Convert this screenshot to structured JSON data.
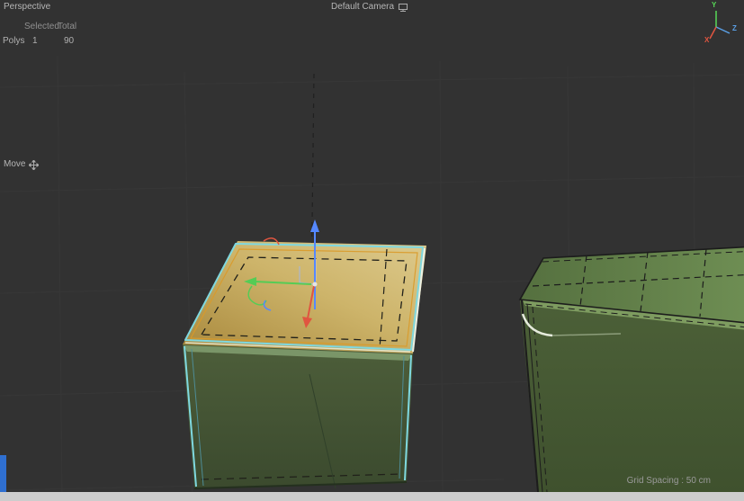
{
  "viewport": {
    "view_label": "Perspective",
    "camera_label": "Default Camera",
    "tool_label": "Move",
    "grid_spacing_label": "Grid Spacing : 50 cm"
  },
  "stats": {
    "header_selected": "Selected",
    "header_total": "Total",
    "rows": [
      {
        "label": "Polys",
        "selected": "1",
        "total": "90"
      }
    ]
  },
  "axis_gizmo": {
    "x": "X",
    "y": "Y",
    "z": "Z"
  },
  "colors": {
    "background": "#323232",
    "selection_highlight": "#7fd8e0",
    "selected_face_tan": "#d2b96a",
    "box_green": "#55703f",
    "gizmo_arrow_up": "#5588ff",
    "gizmo_arrow_left": "#55cc55",
    "gizmo_arrow_front": "#e05540",
    "axis_x": "#e05540",
    "axis_y": "#57d957",
    "axis_z": "#5aa0e6",
    "bottom_strip": "#cdcdcd",
    "blue_marker": "#2f6fd0"
  }
}
